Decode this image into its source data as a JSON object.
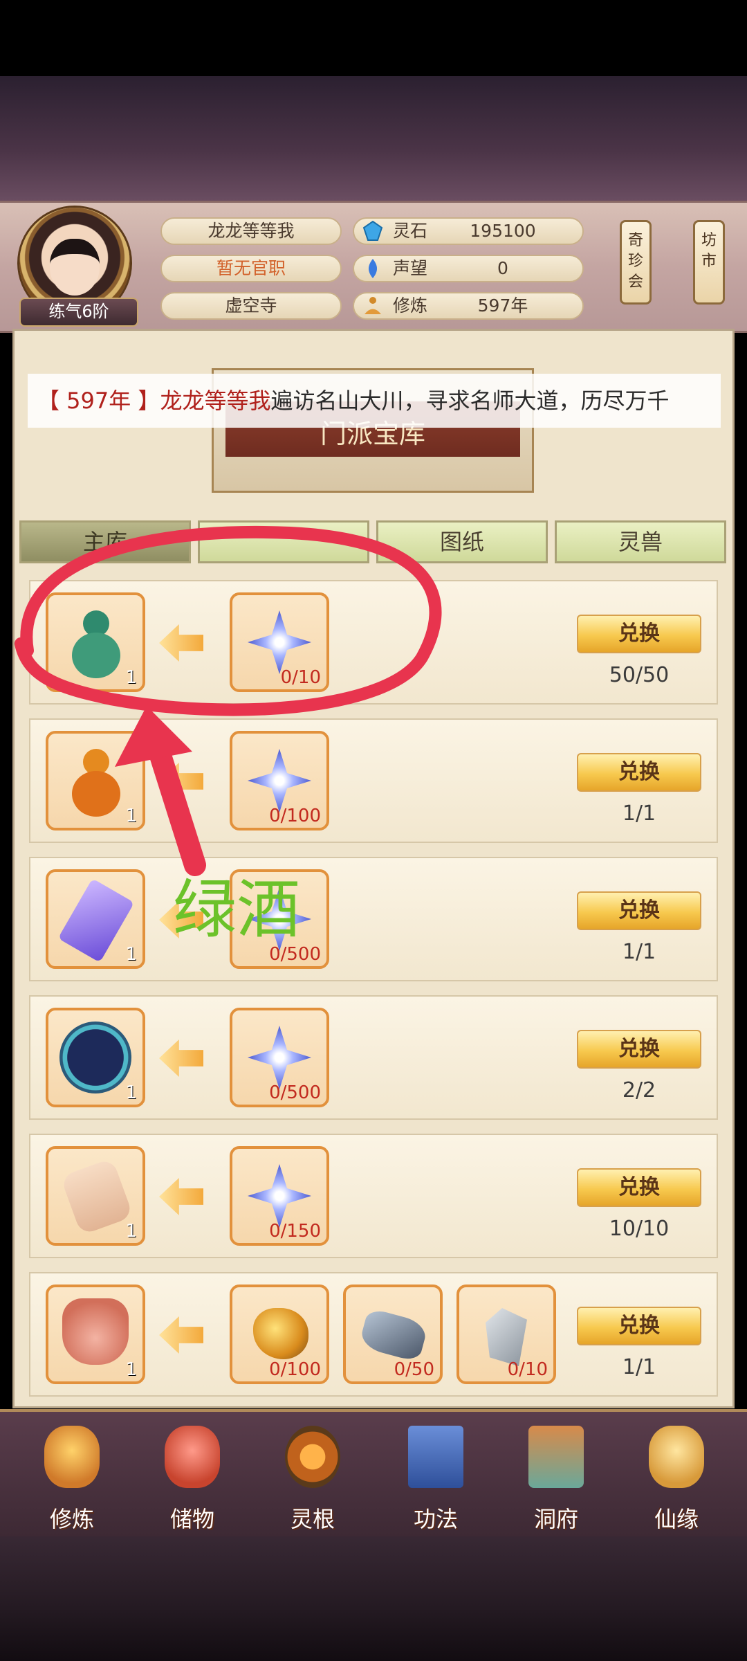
{
  "player": {
    "level_badge": "练气6阶",
    "name": "龙龙等等我",
    "official_title": "暂无官职",
    "sect": "虚空寺"
  },
  "resources": [
    {
      "label": "灵石",
      "value": "195100",
      "icon": "spirit-stone-icon"
    },
    {
      "label": "声望",
      "value": "0",
      "icon": "prestige-icon"
    },
    {
      "label": "修炼",
      "value": "597年",
      "icon": "meditation-icon"
    }
  ],
  "side_buttons": [
    {
      "label": "奇珍会"
    },
    {
      "label": "坊市"
    }
  ],
  "panel": {
    "title": "门派宝库"
  },
  "marquee": {
    "year": "【 597年 】",
    "name": "龙龙等等我",
    "text": "遍访名山大川，寻求名师大道，历尽万千"
  },
  "tabs": [
    {
      "label": "主库",
      "active": true
    },
    {
      "label": "",
      "active": false
    },
    {
      "label": "图纸",
      "active": false
    },
    {
      "label": "灵兽",
      "active": false
    }
  ],
  "exchange_rows": [
    {
      "reward": "green-gourd",
      "reward_qty": "1",
      "costs": [
        {
          "item": "star-gem",
          "count": "0/10"
        }
      ],
      "button": "兑换",
      "stock": "50/50"
    },
    {
      "reward": "orange-gourd",
      "reward_qty": "1",
      "costs": [
        {
          "item": "star-gem",
          "count": "0/100"
        }
      ],
      "button": "兑换",
      "stock": "1/1"
    },
    {
      "reward": "talisman",
      "reward_qty": "1",
      "costs": [
        {
          "item": "star-gem",
          "count": "0/500"
        }
      ],
      "button": "兑换",
      "stock": "1/1"
    },
    {
      "reward": "star-disc",
      "reward_qty": "1",
      "costs": [
        {
          "item": "star-gem",
          "count": "0/500"
        }
      ],
      "button": "兑换",
      "stock": "2/2"
    },
    {
      "reward": "scroll",
      "reward_qty": "1",
      "costs": [
        {
          "item": "star-gem",
          "count": "0/150"
        }
      ],
      "button": "兑换",
      "stock": "10/10"
    },
    {
      "reward": "cauldron",
      "reward_qty": "1",
      "costs": [
        {
          "item": "gold-ore",
          "count": "0/100"
        },
        {
          "item": "iron-ore",
          "count": "0/50"
        },
        {
          "item": "stone-shard",
          "count": "0/10"
        }
      ],
      "button": "兑换",
      "stock": "1/1"
    }
  ],
  "annotation": {
    "text": "绿酒",
    "color": "#6cc22a",
    "stroke_color": "#e8344e"
  },
  "nav": [
    {
      "label": "修炼",
      "icon": "cultivation-icon"
    },
    {
      "label": "储物",
      "icon": "storage-bag-icon"
    },
    {
      "label": "灵根",
      "icon": "spirit-root-icon"
    },
    {
      "label": "功法",
      "icon": "technique-book-icon"
    },
    {
      "label": "洞府",
      "icon": "cave-dwelling-icon"
    },
    {
      "label": "仙缘",
      "icon": "immortal-fate-icon"
    }
  ]
}
